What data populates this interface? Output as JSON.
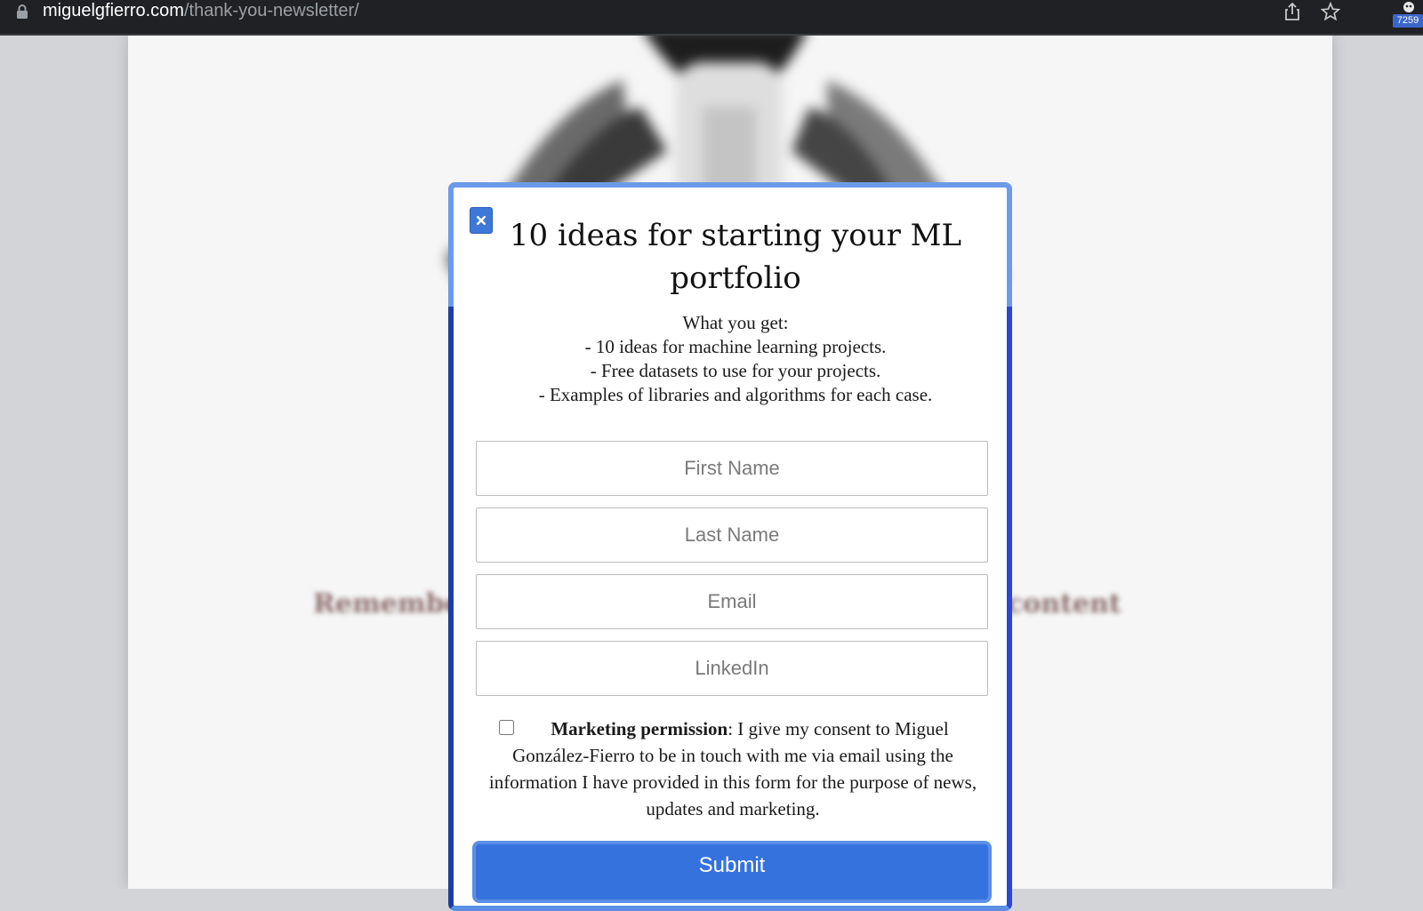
{
  "browser": {
    "url_host": "miguelgfierro.com",
    "url_path": "/thank-you-newsletter/",
    "extension_badge": "7259",
    "icons": [
      "lock-icon",
      "share-icon",
      "star-icon",
      "extension-icon"
    ]
  },
  "background": {
    "blurred_text_left": "Remember",
    "blurred_text_right": "content"
  },
  "modal": {
    "title": "10 ideas for starting your ML portfolio",
    "description": {
      "heading": "What you get:",
      "items": [
        "- 10 ideas for machine learning projects.",
        "- Free datasets to use for your projects.",
        "- Examples of libraries and algorithms for each case."
      ]
    },
    "fields": {
      "first_name": {
        "placeholder": "First Name",
        "value": ""
      },
      "last_name": {
        "placeholder": "Last Name",
        "value": ""
      },
      "email": {
        "placeholder": "Email",
        "value": ""
      },
      "linkedin": {
        "placeholder": "LinkedIn",
        "value": ""
      }
    },
    "consent": {
      "checked": false,
      "label_bold": "Marketing permission",
      "label_text": ": I give my consent to Miguel González-Fierro to be in touch with me via email using the information I have provided in this form for the purpose of news, updates and marketing."
    },
    "submit_label": "Submit"
  },
  "colors": {
    "accent": "#3572de",
    "modal_border": "#5b8fe6",
    "chrome": "#202124"
  }
}
